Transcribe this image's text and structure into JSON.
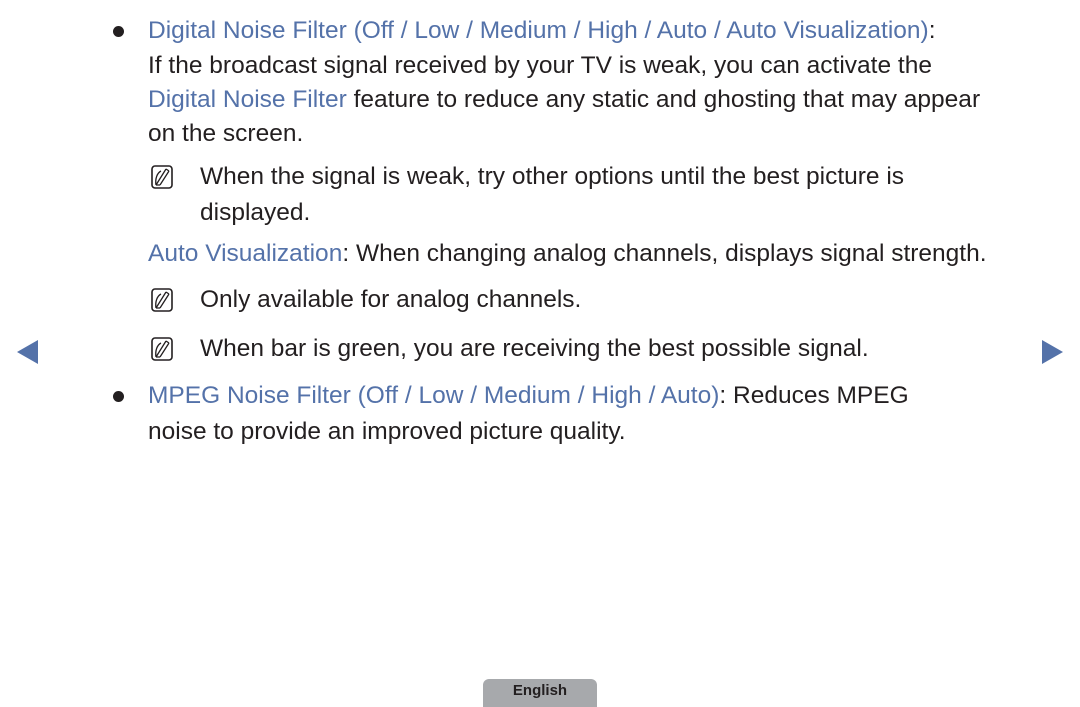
{
  "section1": {
    "title": "Digital Noise Filter (Off / Low / Medium / High / Auto / Auto Visualization)",
    "title_suffix": ":",
    "line2": "If the broadcast signal received by your TV is weak, you can activate the",
    "line3_highlight": "Digital Noise Filter",
    "line3_rest": " feature to reduce any static and ghosting that may appear",
    "line4": "on the screen.",
    "note1_line1": "When the signal is weak, try other options until the best picture is",
    "note1_line2": "displayed.",
    "auto_vis_label": "Auto Visualization",
    "auto_vis_text": ": When changing analog channels, displays signal strength.",
    "note2": "Only available for analog channels.",
    "note3": "When bar is green, you are receiving the best possible signal."
  },
  "section2": {
    "title": "MPEG Noise Filter (Off / Low / Medium / High / Auto)",
    "title_rest": ": Reduces MPEG",
    "line2": "noise to provide an improved picture quality."
  },
  "navigation": {
    "prev_icon": "triangle-left-icon",
    "next_icon": "triangle-right-icon"
  },
  "footer": {
    "language": "English"
  },
  "colors": {
    "accent": "#5472a9",
    "text": "#231f20",
    "tab": "#a7a9ac"
  }
}
